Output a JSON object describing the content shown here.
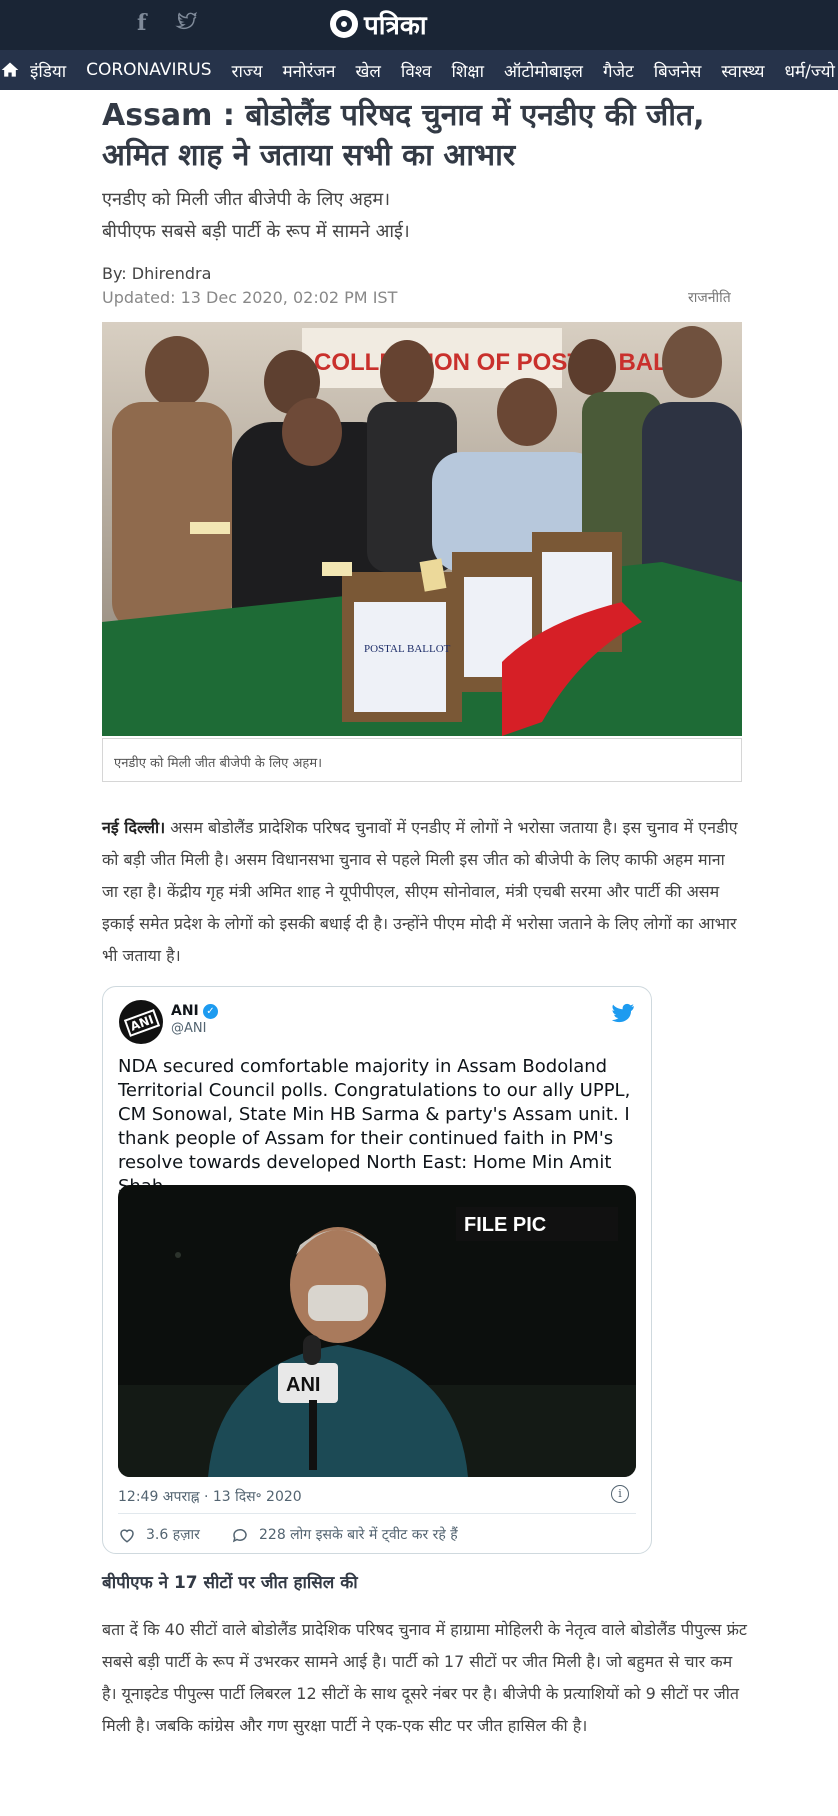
{
  "header": {
    "facebook_icon": "facebook-icon",
    "twitter_icon": "twitter-icon",
    "logo_text": "पत्रिका"
  },
  "nav": {
    "home_icon": "home-icon",
    "items": [
      "इंडिया",
      "CORONAVIRUS",
      "राज्य",
      "मनोरंजन",
      "खेल",
      "विश्व",
      "शिक्षा",
      "ऑटोमोबाइल",
      "गैजेट",
      "बिजनेस",
      "स्वास्थ्य",
      "धर्म/ज्यो"
    ]
  },
  "article": {
    "headline": "Assam  : बोडोलैंड परिषद चुनाव में एनडीए की जीत, अमित शाह ने जताया सभी का आभार",
    "summary_line1": "एनडीए को मिली जीत बीजेपी के लिए अहम।",
    "summary_line2": "बीपीएफ सबसे बड़ी पार्टी के रूप में सामने आई।",
    "byline": "By: Dhirendra",
    "updated": "Updated: 13 Dec 2020, 02:02 PM IST",
    "category": "राजनीति",
    "image_caption": "एनडीए को मिली जीत बीजेपी के लिए अहम।",
    "para1_lead": "नई दिल्ली।",
    "para1": " असम बोडोलैंड प्रादेशिक परिषद चुनावों में एनडीए में लोगों ने भरोसा जताया है। इस चुनाव में एनडीए को बड़ी जीत मिली है। असम विधानसभा चुनाव से पहले मिली इस जीत को बीजेपी के लिए काफी अहम माना जा रहा है। केंद्रीय गृह मंत्री अमित शाह ने यूपीपीएल, सीएम सोनोवाल, मंत्री एचबी सरमा और पार्टी की असम इकाई समेत प्रदेश के लोगों को इसकी बधाई दी है। उन्होंने पीएम मोदी में भरोसा जताने के लिए लोगों का आभार भी जताया है।",
    "subheading": "बीपीएफ ने 17 सीटों पर जीत हासिल की",
    "para2": "बता दें कि 40 सीटों वाले बोडोलैंड प्रादेशिक परिषद चुनाव में हाग्रामा मोहिलरी के नेतृत्व वाले बोडोलैंड पीपुल्स फ्रंट सबसे बड़ी पार्टी के रूप में उभरकर सामने आई है। पार्टी को 17 सीटों पर जीत मिली है। जो बहुमत से चार कम है। यूनाइटेड पीपुल्स पार्टी लिबरल 12 सीटों के साथ दूसरे नंबर पर है। बीजेपी के प्रत्याशियों को 9 सीटों पर जीत मिली है। जबकि कांग्रेस और गण सुरक्षा पार्टी ने एक-एक सीट पर जीत हासिल की है।"
  },
  "hero_image": {
    "banner_text": "COLLECTION OF POSTAL BALLOT",
    "box_label": "POSTAL BALLOT BOX"
  },
  "tweet": {
    "avatar_text": "ANI",
    "user_name": "ANI",
    "handle": "@ANI",
    "text": "NDA secured comfortable majority in Assam Bodoland Territorial Council polls. Congratulations to our ally UPPL, CM Sonowal, State Min HB Sarma & party's Assam unit. I thank people of Assam for their continued faith in PM's resolve towards developed North East: Home Min Amit Shah",
    "media_tag": "FILE PIC",
    "mic_label": "ANI",
    "time": "12:49 अपराह्न · 13 दिस॰ 2020",
    "likes": "3.6 हज़ार",
    "replies": "228 लोग इसके बारे में ट्वीट कर रहे हैं"
  },
  "colors": {
    "header_bg": "#1a2535",
    "nav_bg": "#26334a",
    "twitter_blue": "#1d9bf0"
  }
}
